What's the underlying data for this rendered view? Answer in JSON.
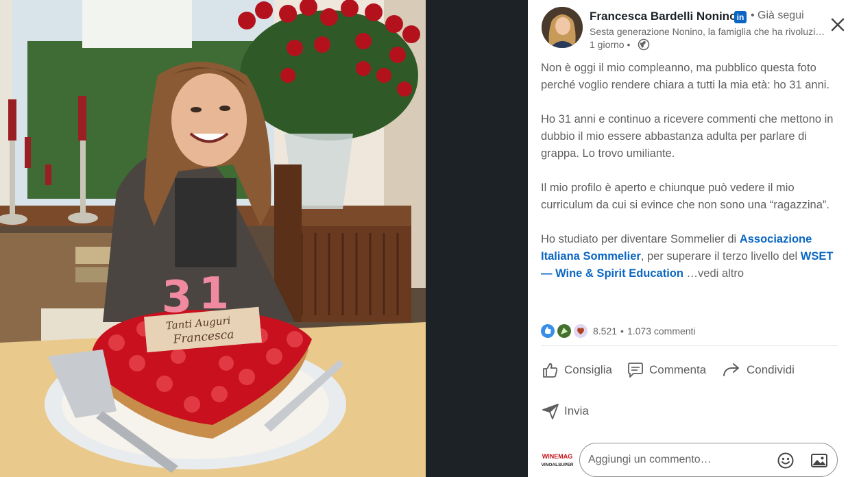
{
  "author": {
    "name": "Francesca Bardelli Nonino",
    "badge": "in",
    "follow_status": "• Già segui",
    "headline": "Sesta generazione Nonino, la famiglia che ha rivoluzionato la grappa",
    "time": "1 giorno •"
  },
  "post": {
    "paragraphs": [
      "Non è oggi il mio compleanno, ma pubblico questa foto perché voglio rendere chiara a tutti la mia età: ho 31 anni.",
      "Ho 31 anni e continuo a ricevere commenti che mettono in dubbio il mio essere abbastanza adulta per parlare di grappa. Lo trovo umiliante.",
      "Il mio profilo è aperto e chiunque può vedere il mio curriculum da cui si evince che non sono una “ragazzina”."
    ],
    "last_before_link": "Ho studiato per diventare Sommelier di",
    "link1": "Associazione Italiana Sommelier",
    "mid_text": ", per superare il terzo livello del",
    "link2": "WSET — Wine & Spirit Education",
    "see_more": "…vedi altro"
  },
  "stats": {
    "reactions": "8.521",
    "separator": "•",
    "comments": "1.073 commenti"
  },
  "actions": {
    "like": "Consiglia",
    "comment": "Commenta",
    "share": "Condividi",
    "send": "Invia"
  },
  "comment_box": {
    "placeholder": "Aggiungi un commento…"
  },
  "photo": {
    "candle_left": "3",
    "candle_right": "1",
    "cake_inscription_1": "Tanti Auguri",
    "cake_inscription_2": "Francesca"
  },
  "logos": {
    "winemag_1": "WINEMAG",
    "winemag_2": "VINOALSUPER"
  },
  "colors": {
    "accent": "#0a66c2",
    "gutter": "#1d2226",
    "text_muted": "#666666"
  },
  "icons": [
    "linkedin-icon",
    "globe-icon",
    "close-icon",
    "like-icon",
    "celebrate-icon",
    "support-icon",
    "comment-icon",
    "share-icon",
    "send-icon",
    "emoji-icon",
    "image-icon"
  ]
}
